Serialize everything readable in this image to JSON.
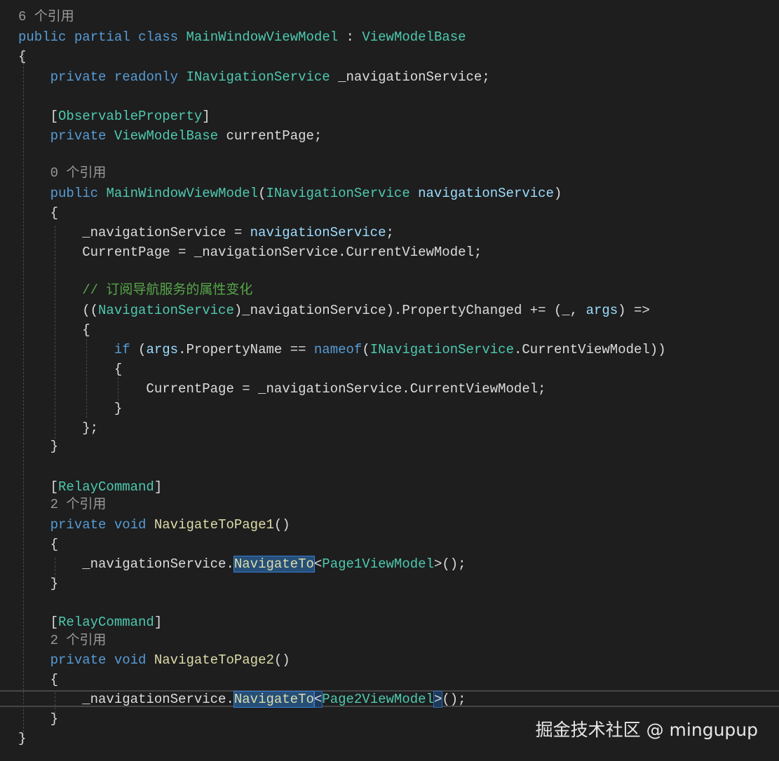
{
  "colors": {
    "background": "#1e1e1e",
    "keyword": "#569cd6",
    "type": "#4ec9b0",
    "method": "#dcdcaa",
    "parameter": "#9cdcfe",
    "comment": "#57a64a",
    "text": "#dcdcdc",
    "codelens": "#999999"
  },
  "editor": {
    "lines": [
      {
        "kind": "lens",
        "text": "6 个引用"
      },
      {
        "tokens": [
          [
            "public",
            "kw"
          ],
          [
            " ",
            "pl"
          ],
          [
            "partial",
            "kw"
          ],
          [
            " ",
            "pl"
          ],
          [
            "class",
            "kw"
          ],
          [
            " ",
            "pl"
          ],
          [
            "MainWindowViewModel",
            "ty"
          ],
          [
            " : ",
            "pl"
          ],
          [
            "ViewModelBase",
            "ty"
          ]
        ]
      },
      {
        "tokens": [
          [
            "{",
            "pl"
          ]
        ]
      },
      {
        "tokens": [
          [
            "    ",
            "pl"
          ],
          [
            "private",
            "kw"
          ],
          [
            " ",
            "pl"
          ],
          [
            "readonly",
            "kw"
          ],
          [
            " ",
            "pl"
          ],
          [
            "INavigationService",
            "ty"
          ],
          [
            " _navigationService;",
            "pl"
          ]
        ]
      },
      {
        "tokens": []
      },
      {
        "tokens": [
          [
            "    [",
            "pl"
          ],
          [
            "ObservableProperty",
            "ty"
          ],
          [
            "]",
            "pl"
          ]
        ]
      },
      {
        "tokens": [
          [
            "    ",
            "pl"
          ],
          [
            "private",
            "kw"
          ],
          [
            " ",
            "pl"
          ],
          [
            "ViewModelBase",
            "ty"
          ],
          [
            " currentPage;",
            "pl"
          ]
        ]
      },
      {
        "tokens": []
      },
      {
        "kind": "lens",
        "indent": "    ",
        "text": "0 个引用"
      },
      {
        "tokens": [
          [
            "    ",
            "pl"
          ],
          [
            "public",
            "kw"
          ],
          [
            " ",
            "pl"
          ],
          [
            "MainWindowViewModel",
            "ty"
          ],
          [
            "(",
            "pl"
          ],
          [
            "INavigationService",
            "ty"
          ],
          [
            " ",
            "pl"
          ],
          [
            "navigationService",
            "pa"
          ],
          [
            ")",
            "pl"
          ]
        ]
      },
      {
        "tokens": [
          [
            "    {",
            "pl"
          ]
        ]
      },
      {
        "tokens": [
          [
            "        _navigationService = ",
            "pl"
          ],
          [
            "navigationService",
            "pa"
          ],
          [
            ";",
            "pl"
          ]
        ]
      },
      {
        "tokens": [
          [
            "        CurrentPage = _navigationService.CurrentViewModel;",
            "pl"
          ]
        ]
      },
      {
        "tokens": []
      },
      {
        "tokens": [
          [
            "        ",
            "pl"
          ],
          [
            "// 订阅导航服务的属性变化",
            "cm"
          ]
        ]
      },
      {
        "tokens": [
          [
            "        ((",
            "pl"
          ],
          [
            "NavigationService",
            "ty"
          ],
          [
            ")_navigationService).PropertyChanged += (_, ",
            "pl"
          ],
          [
            "args",
            "pa"
          ],
          [
            ") =>",
            "pl"
          ]
        ]
      },
      {
        "tokens": [
          [
            "        {",
            "pl"
          ]
        ]
      },
      {
        "tokens": [
          [
            "            ",
            "pl"
          ],
          [
            "if",
            "kw"
          ],
          [
            " (",
            "pl"
          ],
          [
            "args",
            "pa"
          ],
          [
            ".PropertyName == ",
            "pl"
          ],
          [
            "nameof",
            "kw"
          ],
          [
            "(",
            "pl"
          ],
          [
            "INavigationService",
            "ty"
          ],
          [
            ".CurrentViewModel))",
            "pl"
          ]
        ]
      },
      {
        "tokens": [
          [
            "            {",
            "pl"
          ]
        ]
      },
      {
        "tokens": [
          [
            "                CurrentPage = _navigationService.CurrentViewModel;",
            "pl"
          ]
        ]
      },
      {
        "tokens": [
          [
            "            }",
            "pl"
          ]
        ]
      },
      {
        "tokens": [
          [
            "        };",
            "pl"
          ]
        ]
      },
      {
        "tokens": [
          [
            "    }",
            "pl"
          ]
        ]
      },
      {
        "tokens": []
      },
      {
        "tokens": [
          [
            "    [",
            "pl"
          ],
          [
            "RelayCommand",
            "ty"
          ],
          [
            "]",
            "pl"
          ]
        ]
      },
      {
        "kind": "lens",
        "indent": "    ",
        "text": "2 个引用"
      },
      {
        "tokens": [
          [
            "    ",
            "pl"
          ],
          [
            "private",
            "kw"
          ],
          [
            " ",
            "pl"
          ],
          [
            "void",
            "kw"
          ],
          [
            " ",
            "pl"
          ],
          [
            "NavigateToPage1",
            "me"
          ],
          [
            "()",
            "pl"
          ]
        ]
      },
      {
        "tokens": [
          [
            "    {",
            "pl"
          ]
        ]
      },
      {
        "tokens": [
          [
            "        _navigationService.",
            "pl"
          ],
          [
            "NavigateTo",
            "me",
            "hl"
          ],
          [
            "<",
            "pl"
          ],
          [
            "Page1ViewModel",
            "ty"
          ],
          [
            ">();",
            "pl"
          ]
        ]
      },
      {
        "tokens": [
          [
            "    }",
            "pl"
          ]
        ]
      },
      {
        "tokens": []
      },
      {
        "tokens": [
          [
            "    [",
            "pl"
          ],
          [
            "RelayCommand",
            "ty"
          ],
          [
            "]",
            "pl"
          ]
        ]
      },
      {
        "kind": "lens",
        "indent": "    ",
        "text": "2 个引用"
      },
      {
        "tokens": [
          [
            "    ",
            "pl"
          ],
          [
            "private",
            "kw"
          ],
          [
            " ",
            "pl"
          ],
          [
            "void",
            "kw"
          ],
          [
            " ",
            "pl"
          ],
          [
            "NavigateToPage2",
            "me"
          ],
          [
            "()",
            "pl"
          ]
        ]
      },
      {
        "tokens": [
          [
            "    {",
            "pl"
          ]
        ]
      },
      {
        "tokens": [
          [
            "        _navigationService.",
            "pl"
          ],
          [
            "NavigateTo",
            "me",
            "hl"
          ],
          [
            "<",
            "pl",
            "bh"
          ],
          [
            "Page2ViewModel",
            "ty"
          ],
          [
            ">",
            "pl",
            "bh"
          ],
          [
            "();",
            "pl"
          ]
        ]
      },
      {
        "tokens": [
          [
            "    }",
            "pl"
          ]
        ]
      },
      {
        "tokens": [
          [
            "}",
            "pl"
          ]
        ]
      }
    ]
  },
  "watermark": {
    "text": "掘金技术社区 @ mingupup"
  }
}
